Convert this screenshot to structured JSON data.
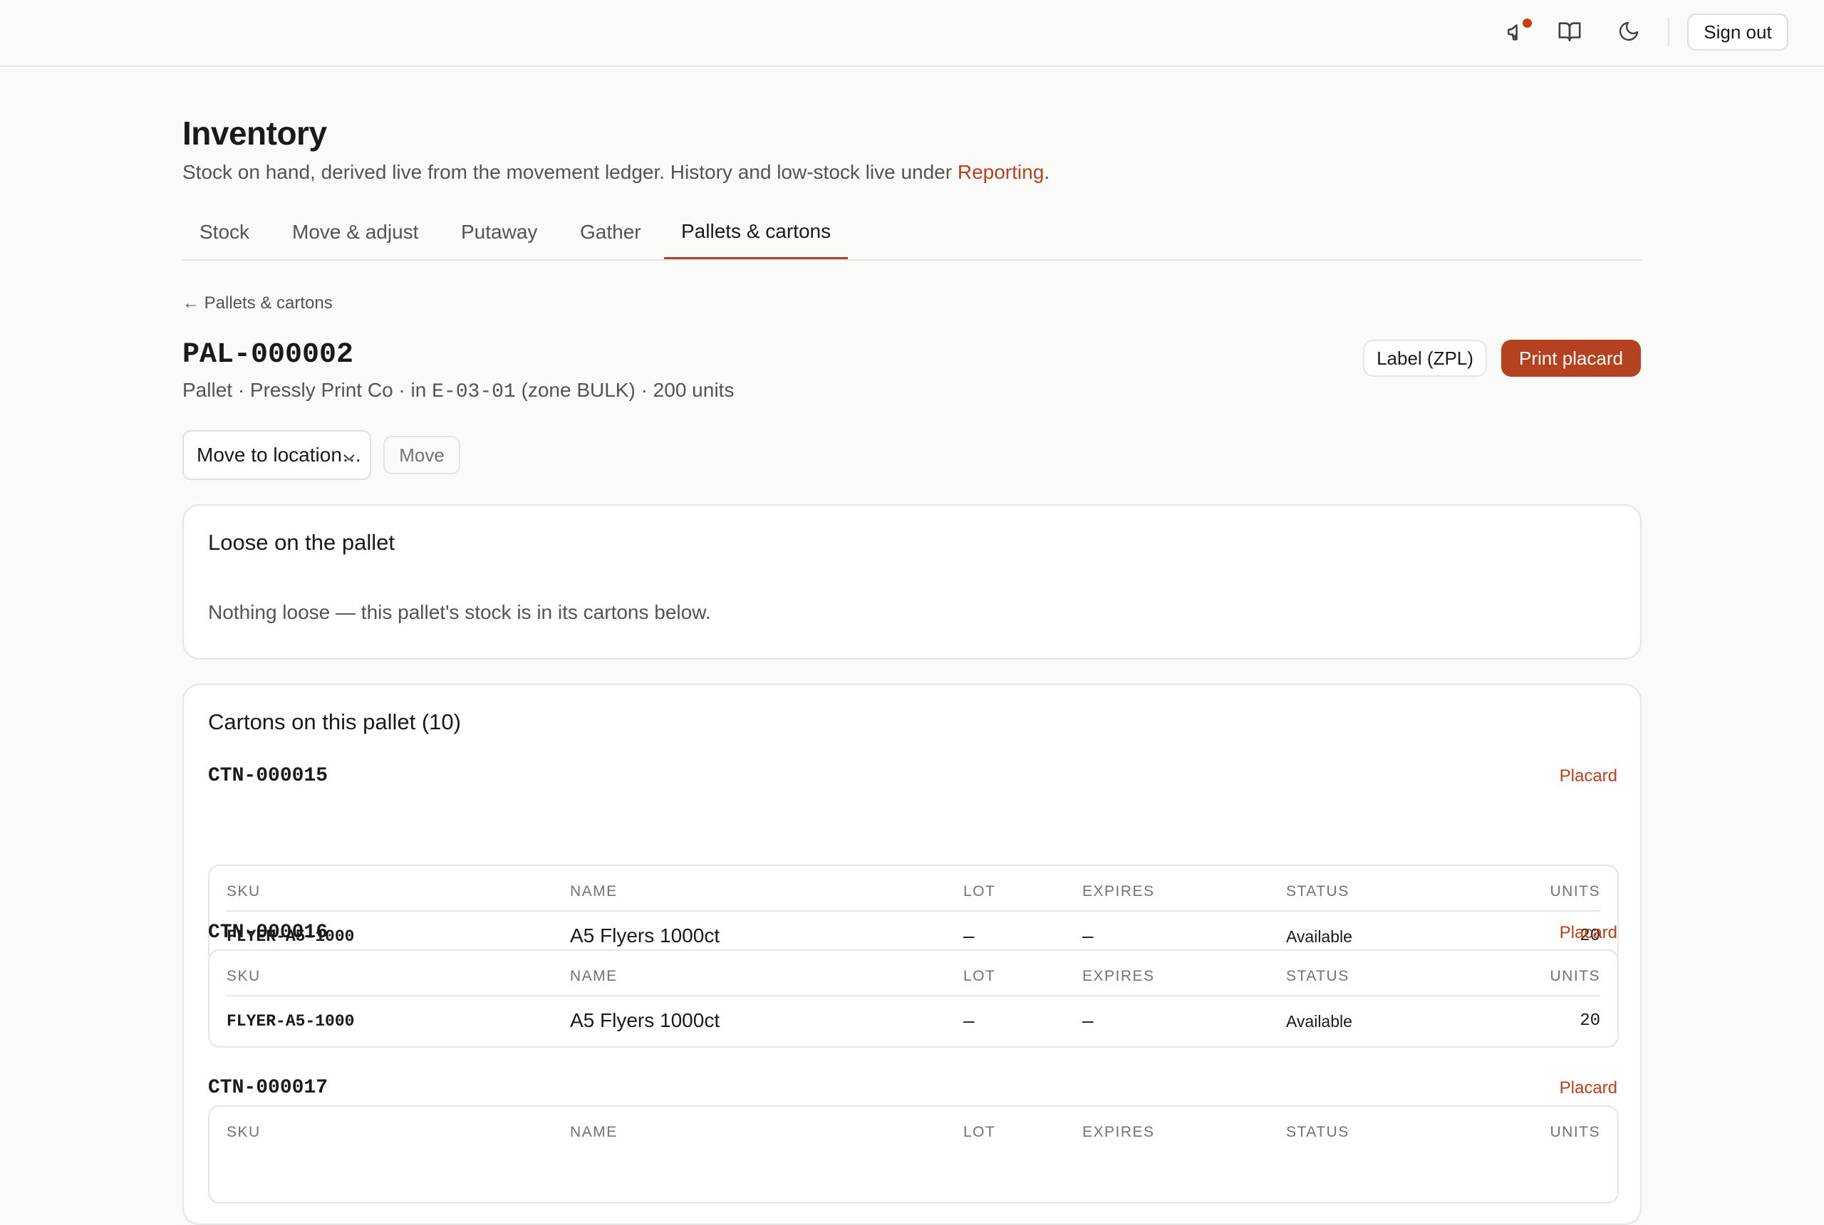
{
  "topbar": {
    "announcements_icon": "megaphone-icon",
    "docs_icon": "book-icon",
    "theme_icon": "moon-icon",
    "signout_label": "Sign out"
  },
  "page": {
    "title": "Inventory",
    "subtitle_prefix": "Stock on hand, derived live from the movement ledger. History and low-stock live under ",
    "subtitle_link": "Reporting",
    "subtitle_suffix": "."
  },
  "tabs": [
    {
      "label": "Stock",
      "active": false
    },
    {
      "label": "Move & adjust",
      "active": false
    },
    {
      "label": "Putaway",
      "active": false
    },
    {
      "label": "Gather",
      "active": false
    },
    {
      "label": "Pallets & cartons",
      "active": true
    }
  ],
  "pallet": {
    "back_label": "← Pallets & cartons",
    "id": "PAL-000002",
    "meta_prefix": "Pallet · Pressly Print Co · in ",
    "location": "E-03-01",
    "meta_suffix": " (zone BULK) · 200 units",
    "label_button": "Label (ZPL)",
    "print_button": "Print placard",
    "move_select_placeholder": "Move to location…",
    "move_button": "Move"
  },
  "loose": {
    "title": "Loose on the pallet",
    "empty_text": "Nothing loose — this pallet's stock is in its cartons below."
  },
  "cartons": {
    "title": "Cartons on this pallet (10)",
    "placard_label": "Placard",
    "columns": [
      "SKU",
      "NAME",
      "LOT",
      "EXPIRES",
      "STATUS",
      "UNITS"
    ],
    "items": [
      {
        "id": "CTN-000015",
        "sku": "FLYER-A5-1000",
        "name": "A5 Flyers 1000ct",
        "lot": "–",
        "expires": "–",
        "status": "Available",
        "units": "20"
      },
      {
        "id": "CTN-000016",
        "sku": "FLYER-A5-1000",
        "name": "A5 Flyers 1000ct",
        "lot": "–",
        "expires": "–",
        "status": "Available",
        "units": "20"
      },
      {
        "id": "CTN-000017"
      }
    ]
  },
  "colors": {
    "accent": "#b4411f",
    "background": "#fafaf9",
    "border": "#e7e5e4",
    "muted_text": "#57534e"
  }
}
